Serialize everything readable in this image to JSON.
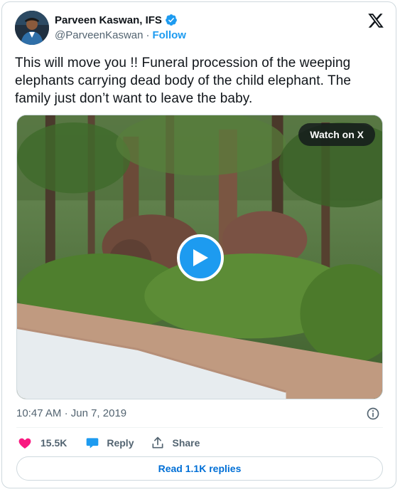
{
  "author": {
    "name": "Parveen Kaswan, IFS",
    "handle": "@ParveenKaswan",
    "separator": "·",
    "follow_label": "Follow"
  },
  "tweet": {
    "text": "This will move you !! Funeral procession of the weeping elephants carrying dead body of the child elephant. The family just don’t want to leave the baby."
  },
  "media": {
    "watch_label": "Watch on X",
    "icon": "play-icon"
  },
  "meta": {
    "time": "10:47 AM",
    "separator": "·",
    "date": "Jun 7, 2019"
  },
  "actions": {
    "likes": "15.5K",
    "reply_label": "Reply",
    "share_label": "Share"
  },
  "footer": {
    "read_replies_label": "Read 1.1K replies"
  },
  "colors": {
    "accent": "#1d9bf0",
    "like": "#f91880",
    "text": "#0f1419",
    "muted": "#536471",
    "border": "#cfd9de"
  }
}
